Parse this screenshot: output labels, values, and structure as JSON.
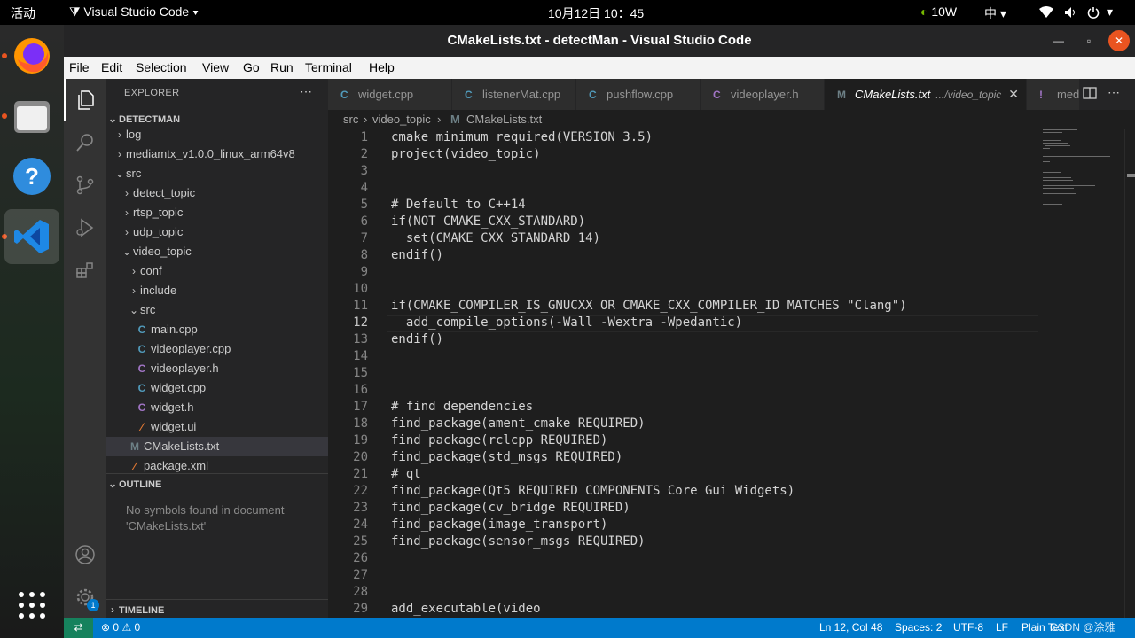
{
  "topbar": {
    "activities": "活动",
    "app_name": "Visual Studio Code",
    "clock": "10月12日 10：45",
    "gpu_power": "10W",
    "input_method": "中"
  },
  "window": {
    "title": "CMakeLists.txt - detectMan - Visual Studio Code"
  },
  "menu": [
    "File",
    "Edit",
    "Selection",
    "View",
    "Go",
    "Run",
    "Terminal",
    "Help"
  ],
  "sidebar": {
    "header": "EXPLORER",
    "root": "DETECTMAN",
    "tree": [
      {
        "label": "log",
        "type": "folder",
        "chev": "›",
        "indent": 1
      },
      {
        "label": "mediamtx_v1.0.0_linux_arm64v8",
        "type": "folder",
        "chev": "›",
        "indent": 1
      },
      {
        "label": "src",
        "type": "folder",
        "chev": "⌄",
        "indent": 1
      },
      {
        "label": "detect_topic",
        "type": "folder",
        "chev": "›",
        "indent": 2
      },
      {
        "label": "rtsp_topic",
        "type": "folder",
        "chev": "›",
        "indent": 2
      },
      {
        "label": "udp_topic",
        "type": "folder",
        "chev": "›",
        "indent": 2
      },
      {
        "label": "video_topic",
        "type": "folder",
        "chev": "⌄",
        "indent": 2
      },
      {
        "label": "conf",
        "type": "folder",
        "chev": "›",
        "indent": 3
      },
      {
        "label": "include",
        "type": "folder",
        "chev": "›",
        "indent": 3
      },
      {
        "label": "src",
        "type": "folder",
        "chev": "⌄",
        "indent": 3
      },
      {
        "label": "main.cpp",
        "type": "cpp",
        "indent": 4
      },
      {
        "label": "videoplayer.cpp",
        "type": "cpp",
        "indent": 4
      },
      {
        "label": "videoplayer.h",
        "type": "h",
        "indent": 4
      },
      {
        "label": "widget.cpp",
        "type": "cpp",
        "indent": 4
      },
      {
        "label": "widget.h",
        "type": "h",
        "indent": 4
      },
      {
        "label": "widget.ui",
        "type": "xml",
        "indent": 4
      },
      {
        "label": "CMakeLists.txt",
        "type": "cmake",
        "indent": 3,
        "selected": true
      },
      {
        "label": "package.xml",
        "type": "xml",
        "indent": 3
      }
    ],
    "outline_header": "OUTLINE",
    "outline_msg_1": "No symbols found in document",
    "outline_msg_2": "'CMakeLists.txt'",
    "timeline_header": "TIMELINE",
    "settings_badge": "1"
  },
  "tabs": [
    {
      "label": "widget.cpp",
      "type": "cpp"
    },
    {
      "label": "listenerMat.cpp",
      "type": "cpp"
    },
    {
      "label": "pushflow.cpp",
      "type": "cpp"
    },
    {
      "label": "videoplayer.h",
      "type": "h"
    },
    {
      "label": "CMakeLists.txt",
      "type": "cmake",
      "detail": ".../video_topic",
      "active": true
    },
    {
      "label": "med",
      "type": "md"
    }
  ],
  "breadcrumb": [
    "src",
    "video_topic",
    "CMakeLists.txt"
  ],
  "editor": {
    "current_line": 12,
    "lines": [
      "cmake_minimum_required(VERSION 3.5)",
      "project(video_topic)",
      "",
      "",
      "# Default to C++14",
      "if(NOT CMAKE_CXX_STANDARD)",
      "  set(CMAKE_CXX_STANDARD 14)",
      "endif()",
      "",
      "",
      "if(CMAKE_COMPILER_IS_GNUCXX OR CMAKE_CXX_COMPILER_ID MATCHES \"Clang\")",
      "  add_compile_options(-Wall -Wextra -Wpedantic)",
      "endif()",
      "",
      "",
      "",
      "# find dependencies",
      "find_package(ament_cmake REQUIRED)",
      "find_package(rclcpp REQUIRED)",
      "find_package(std_msgs REQUIRED)",
      "# qt",
      "find_package(Qt5 REQUIRED COMPONENTS Core Gui Widgets)",
      "find_package(cv_bridge REQUIRED)",
      "find_package(image_transport)",
      "find_package(sensor_msgs REQUIRED)",
      "",
      "",
      "",
      "add_executable(video"
    ]
  },
  "status": {
    "errors": "0",
    "warnings": "0",
    "position": "Ln 12, Col 48",
    "spaces": "Spaces: 2",
    "encoding": "UTF-8",
    "eol": "LF",
    "language": "Plain Text",
    "watermark": "CSDN @涂雅"
  },
  "colors": {
    "accent": "#007acc",
    "cpp_icon": "#519aba",
    "h_icon": "#a074c4",
    "xml_icon": "#e37933",
    "cmake_icon": "#6d8086",
    "ubuntu_orange": "#e95420"
  }
}
